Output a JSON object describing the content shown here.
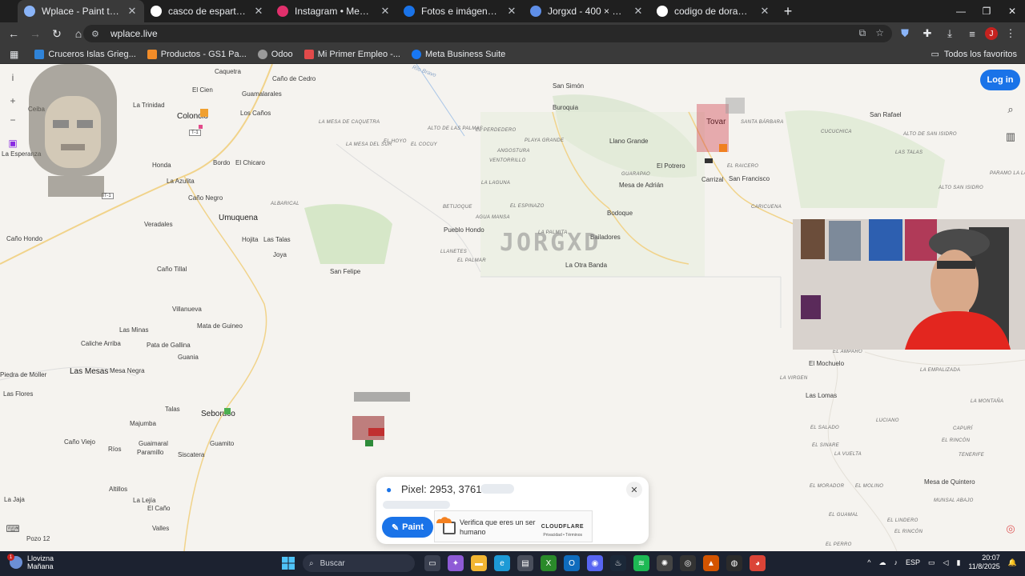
{
  "tabs": [
    {
      "title": "Wplace - Paint the world",
      "color": "#e8eaed",
      "active": true
    },
    {
      "title": "casco de espartano pixel - Goo",
      "color": "#4285f4"
    },
    {
      "title": "Instagram • Mensajes",
      "color": "#e1306c"
    },
    {
      "title": "Fotos e imágenes de Mujer rela",
      "color": "#1a73e8"
    },
    {
      "title": "Jorgxd - 400 × 400 px",
      "color": "#5f8fe8"
    },
    {
      "title": "codigo de dorado - Google Sea",
      "color": "#4285f4"
    }
  ],
  "address": {
    "url": "wplace.live"
  },
  "bookmarks": [
    {
      "label": "Cruceros Islas Grieg...",
      "color": "#2f83d8"
    },
    {
      "label": "Productos - GS1 Pa...",
      "color": "#f28c28"
    },
    {
      "label": "Odoo",
      "color": "#9a9a9a"
    },
    {
      "label": "Mi Primer Empleo -...",
      "color": "#e24a4a"
    },
    {
      "label": "Meta Business Suite",
      "color": "#1877f2"
    }
  ],
  "all_bookmarks": "Todos los favoritos",
  "map": {
    "login": "Log in",
    "places": [
      {
        "t": "Caquetra",
        "c": ""
      },
      {
        "t": "Caño de Cedro",
        "c": ""
      },
      {
        "t": "El Cien",
        "c": ""
      },
      {
        "t": "Guamalarales",
        "c": ""
      },
      {
        "t": "Ceiba",
        "c": ""
      },
      {
        "t": "La Trinidad",
        "c": ""
      },
      {
        "t": "Colonció",
        "c": "big"
      },
      {
        "t": "Los Caños",
        "c": ""
      },
      {
        "t": "La Esperanza",
        "c": ""
      },
      {
        "t": "Honda",
        "c": ""
      },
      {
        "t": "Bordo",
        "c": ""
      },
      {
        "t": "El Chicaro",
        "c": ""
      },
      {
        "t": "La Azulita",
        "c": ""
      },
      {
        "t": "Caño Negro",
        "c": ""
      },
      {
        "t": "Umuquena",
        "c": "big"
      },
      {
        "t": "Veradales",
        "c": ""
      },
      {
        "t": "Caño Hondo",
        "c": ""
      },
      {
        "t": "Hojita",
        "c": ""
      },
      {
        "t": "Las Talas",
        "c": ""
      },
      {
        "t": "Joya",
        "c": ""
      },
      {
        "t": "San Felipe",
        "c": ""
      },
      {
        "t": "Caño Tillal",
        "c": ""
      },
      {
        "t": "Villanueva",
        "c": ""
      },
      {
        "t": "Mata de Guineo",
        "c": ""
      },
      {
        "t": "Las Minas",
        "c": ""
      },
      {
        "t": "Caliche Arriba",
        "c": ""
      },
      {
        "t": "Pata de Gallina",
        "c": ""
      },
      {
        "t": "Guania",
        "c": ""
      },
      {
        "t": "Piedra de Moller",
        "c": ""
      },
      {
        "t": "Las Mesas",
        "c": "big"
      },
      {
        "t": "Mesa Negra",
        "c": ""
      },
      {
        "t": "Las Flores",
        "c": ""
      },
      {
        "t": "Talas",
        "c": ""
      },
      {
        "t": "Seboruco",
        "c": "big"
      },
      {
        "t": "Majumba",
        "c": ""
      },
      {
        "t": "Caño Viejo",
        "c": ""
      },
      {
        "t": "Ríos",
        "c": ""
      },
      {
        "t": "Guaimaral",
        "c": ""
      },
      {
        "t": "Guamito",
        "c": ""
      },
      {
        "t": "Paramillo",
        "c": ""
      },
      {
        "t": "Siscatera",
        "c": ""
      },
      {
        "t": "Altillos",
        "c": ""
      },
      {
        "t": "La Lejía",
        "c": ""
      },
      {
        "t": "La Jaja",
        "c": ""
      },
      {
        "t": "El Caño",
        "c": ""
      },
      {
        "t": "Valles",
        "c": ""
      },
      {
        "t": "Pozo 12",
        "c": ""
      },
      {
        "t": "San Simón",
        "c": ""
      },
      {
        "t": "Buroquia",
        "c": ""
      },
      {
        "t": "Llano Grande",
        "c": ""
      },
      {
        "t": "El Potrero",
        "c": ""
      },
      {
        "t": "Mesa de Adrián",
        "c": ""
      },
      {
        "t": "Bodoque",
        "c": ""
      },
      {
        "t": "Bailadores",
        "c": ""
      },
      {
        "t": "La Otra Banda",
        "c": ""
      },
      {
        "t": "Pueblo Hondo",
        "c": ""
      },
      {
        "t": "Carrizal",
        "c": ""
      },
      {
        "t": "San Francisco",
        "c": ""
      },
      {
        "t": "Tovar",
        "c": "big"
      },
      {
        "t": "San Rafael",
        "c": ""
      },
      {
        "t": "El Mochuelo",
        "c": ""
      },
      {
        "t": "Las Lomas",
        "c": ""
      },
      {
        "t": "Mesa de Quintero",
        "c": ""
      }
    ],
    "regions": [
      "EL PERDEDERO",
      "ALTO DE LAS PALMAS",
      "LA MESA DEL SUR",
      "EL HOYO",
      "EL COCUY",
      "BETIJOQUE",
      "AGUA MANSA",
      "LLANETES",
      "EL PALMAR",
      "ALBARICAL",
      "LA MESA DE CAQUETRA",
      "PLAYA GRANDE",
      "ANGOSTURA",
      "VENTORRILLO",
      "LA LAGUNA",
      "EL ESPINAZO",
      "LA PALMITA",
      "GUARAPAO",
      "SANTA BÁRBARA",
      "CUCUCHICA",
      "ALTO DE SAN ISIDRO",
      "LAS TALAS",
      "EL RAICERO",
      "CARICUENA",
      "ALTO SAN ISIDRO",
      "PARAMO LA LAGUNA",
      "EL AMPARO",
      "LA VIRGEN",
      "LA EMPALIZADA",
      "LA MONTAÑA",
      "LUCIANO",
      "CAPURÍ",
      "EL SALADO",
      "EL RINCÓN",
      "TENERIFE",
      "EL SINARE",
      "LA VUELTA",
      "EL MORADOR",
      "EL MOLINO",
      "EL GUAMAL",
      "EL LINDERO",
      "EL RINCÓN",
      "MUNSAL ABAJO",
      "EL PERRO"
    ],
    "river": "Río Bravo",
    "roads": [
      "T-1",
      "T-1"
    ],
    "artwork_text": "JORGXD",
    "pixel_panel": {
      "coords": "Pixel: 2953, 3761",
      "paint": "Paint",
      "captcha_text": "Verifica que eres un ser humano",
      "captcha_brand": "CLOUDFLARE",
      "captcha_links": "Privacidad • Términos"
    }
  },
  "taskbar": {
    "weather_title": "Llovizna",
    "weather_sub": "Mañana",
    "weather_badge": "1",
    "search": "Buscar",
    "lang": "ESP",
    "time": "20:07",
    "date": "11/8/2025"
  }
}
